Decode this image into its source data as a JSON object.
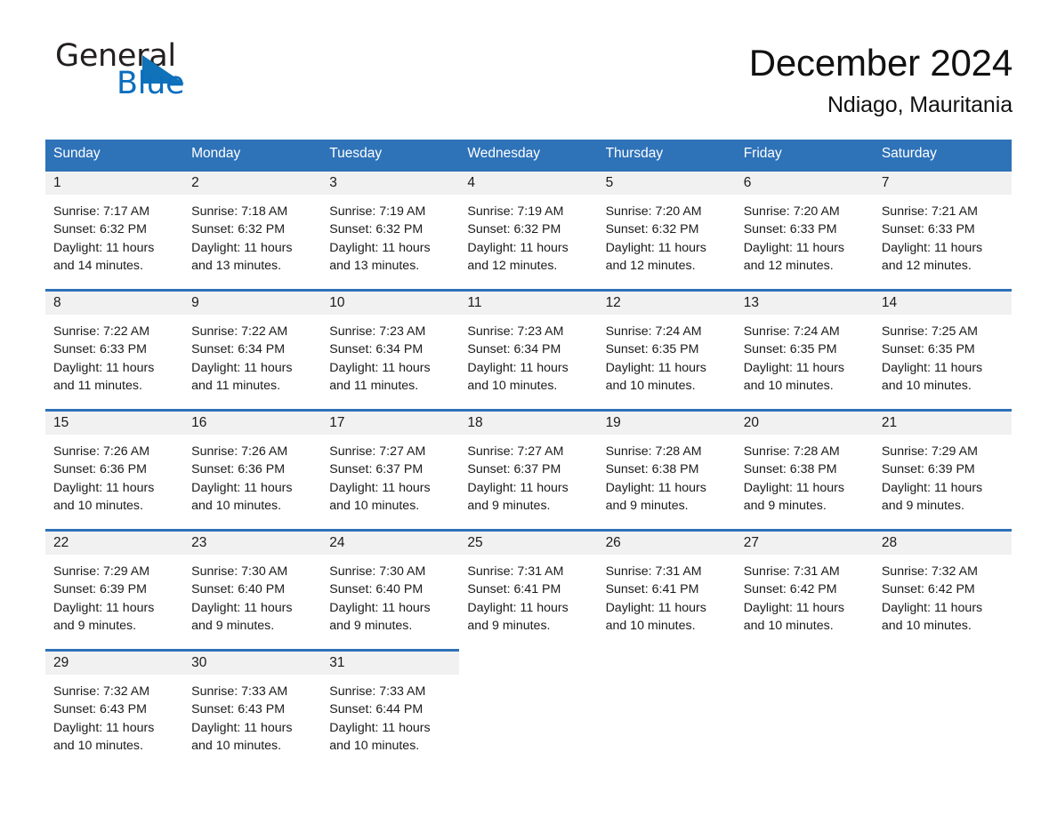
{
  "brand": {
    "name_part1": "General",
    "name_part2": "Blue",
    "triangle_color": "#1072b8"
  },
  "header": {
    "title": "December 2024",
    "location": "Ndiago, Mauritania"
  },
  "theme": {
    "header_blue": "#2e72b8",
    "daynum_band": "#f1f1f1",
    "text": "#1a1a1a",
    "brand_blue": "#0b6ebe"
  },
  "weekdays": [
    "Sunday",
    "Monday",
    "Tuesday",
    "Wednesday",
    "Thursday",
    "Friday",
    "Saturday"
  ],
  "weeks": [
    [
      {
        "day": "1",
        "sunrise": "Sunrise: 7:17 AM",
        "sunset": "Sunset: 6:32 PM",
        "daylight": "Daylight: 11 hours and 14 minutes."
      },
      {
        "day": "2",
        "sunrise": "Sunrise: 7:18 AM",
        "sunset": "Sunset: 6:32 PM",
        "daylight": "Daylight: 11 hours and 13 minutes."
      },
      {
        "day": "3",
        "sunrise": "Sunrise: 7:19 AM",
        "sunset": "Sunset: 6:32 PM",
        "daylight": "Daylight: 11 hours and 13 minutes."
      },
      {
        "day": "4",
        "sunrise": "Sunrise: 7:19 AM",
        "sunset": "Sunset: 6:32 PM",
        "daylight": "Daylight: 11 hours and 12 minutes."
      },
      {
        "day": "5",
        "sunrise": "Sunrise: 7:20 AM",
        "sunset": "Sunset: 6:32 PM",
        "daylight": "Daylight: 11 hours and 12 minutes."
      },
      {
        "day": "6",
        "sunrise": "Sunrise: 7:20 AM",
        "sunset": "Sunset: 6:33 PM",
        "daylight": "Daylight: 11 hours and 12 minutes."
      },
      {
        "day": "7",
        "sunrise": "Sunrise: 7:21 AM",
        "sunset": "Sunset: 6:33 PM",
        "daylight": "Daylight: 11 hours and 12 minutes."
      }
    ],
    [
      {
        "day": "8",
        "sunrise": "Sunrise: 7:22 AM",
        "sunset": "Sunset: 6:33 PM",
        "daylight": "Daylight: 11 hours and 11 minutes."
      },
      {
        "day": "9",
        "sunrise": "Sunrise: 7:22 AM",
        "sunset": "Sunset: 6:34 PM",
        "daylight": "Daylight: 11 hours and 11 minutes."
      },
      {
        "day": "10",
        "sunrise": "Sunrise: 7:23 AM",
        "sunset": "Sunset: 6:34 PM",
        "daylight": "Daylight: 11 hours and 11 minutes."
      },
      {
        "day": "11",
        "sunrise": "Sunrise: 7:23 AM",
        "sunset": "Sunset: 6:34 PM",
        "daylight": "Daylight: 11 hours and 10 minutes."
      },
      {
        "day": "12",
        "sunrise": "Sunrise: 7:24 AM",
        "sunset": "Sunset: 6:35 PM",
        "daylight": "Daylight: 11 hours and 10 minutes."
      },
      {
        "day": "13",
        "sunrise": "Sunrise: 7:24 AM",
        "sunset": "Sunset: 6:35 PM",
        "daylight": "Daylight: 11 hours and 10 minutes."
      },
      {
        "day": "14",
        "sunrise": "Sunrise: 7:25 AM",
        "sunset": "Sunset: 6:35 PM",
        "daylight": "Daylight: 11 hours and 10 minutes."
      }
    ],
    [
      {
        "day": "15",
        "sunrise": "Sunrise: 7:26 AM",
        "sunset": "Sunset: 6:36 PM",
        "daylight": "Daylight: 11 hours and 10 minutes."
      },
      {
        "day": "16",
        "sunrise": "Sunrise: 7:26 AM",
        "sunset": "Sunset: 6:36 PM",
        "daylight": "Daylight: 11 hours and 10 minutes."
      },
      {
        "day": "17",
        "sunrise": "Sunrise: 7:27 AM",
        "sunset": "Sunset: 6:37 PM",
        "daylight": "Daylight: 11 hours and 10 minutes."
      },
      {
        "day": "18",
        "sunrise": "Sunrise: 7:27 AM",
        "sunset": "Sunset: 6:37 PM",
        "daylight": "Daylight: 11 hours and 9 minutes."
      },
      {
        "day": "19",
        "sunrise": "Sunrise: 7:28 AM",
        "sunset": "Sunset: 6:38 PM",
        "daylight": "Daylight: 11 hours and 9 minutes."
      },
      {
        "day": "20",
        "sunrise": "Sunrise: 7:28 AM",
        "sunset": "Sunset: 6:38 PM",
        "daylight": "Daylight: 11 hours and 9 minutes."
      },
      {
        "day": "21",
        "sunrise": "Sunrise: 7:29 AM",
        "sunset": "Sunset: 6:39 PM",
        "daylight": "Daylight: 11 hours and 9 minutes."
      }
    ],
    [
      {
        "day": "22",
        "sunrise": "Sunrise: 7:29 AM",
        "sunset": "Sunset: 6:39 PM",
        "daylight": "Daylight: 11 hours and 9 minutes."
      },
      {
        "day": "23",
        "sunrise": "Sunrise: 7:30 AM",
        "sunset": "Sunset: 6:40 PM",
        "daylight": "Daylight: 11 hours and 9 minutes."
      },
      {
        "day": "24",
        "sunrise": "Sunrise: 7:30 AM",
        "sunset": "Sunset: 6:40 PM",
        "daylight": "Daylight: 11 hours and 9 minutes."
      },
      {
        "day": "25",
        "sunrise": "Sunrise: 7:31 AM",
        "sunset": "Sunset: 6:41 PM",
        "daylight": "Daylight: 11 hours and 9 minutes."
      },
      {
        "day": "26",
        "sunrise": "Sunrise: 7:31 AM",
        "sunset": "Sunset: 6:41 PM",
        "daylight": "Daylight: 11 hours and 10 minutes."
      },
      {
        "day": "27",
        "sunrise": "Sunrise: 7:31 AM",
        "sunset": "Sunset: 6:42 PM",
        "daylight": "Daylight: 11 hours and 10 minutes."
      },
      {
        "day": "28",
        "sunrise": "Sunrise: 7:32 AM",
        "sunset": "Sunset: 6:42 PM",
        "daylight": "Daylight: 11 hours and 10 minutes."
      }
    ],
    [
      {
        "day": "29",
        "sunrise": "Sunrise: 7:32 AM",
        "sunset": "Sunset: 6:43 PM",
        "daylight": "Daylight: 11 hours and 10 minutes."
      },
      {
        "day": "30",
        "sunrise": "Sunrise: 7:33 AM",
        "sunset": "Sunset: 6:43 PM",
        "daylight": "Daylight: 11 hours and 10 minutes."
      },
      {
        "day": "31",
        "sunrise": "Sunrise: 7:33 AM",
        "sunset": "Sunset: 6:44 PM",
        "daylight": "Daylight: 11 hours and 10 minutes."
      },
      {
        "day": "",
        "sunrise": "",
        "sunset": "",
        "daylight": ""
      },
      {
        "day": "",
        "sunrise": "",
        "sunset": "",
        "daylight": ""
      },
      {
        "day": "",
        "sunrise": "",
        "sunset": "",
        "daylight": ""
      },
      {
        "day": "",
        "sunrise": "",
        "sunset": "",
        "daylight": ""
      }
    ]
  ]
}
